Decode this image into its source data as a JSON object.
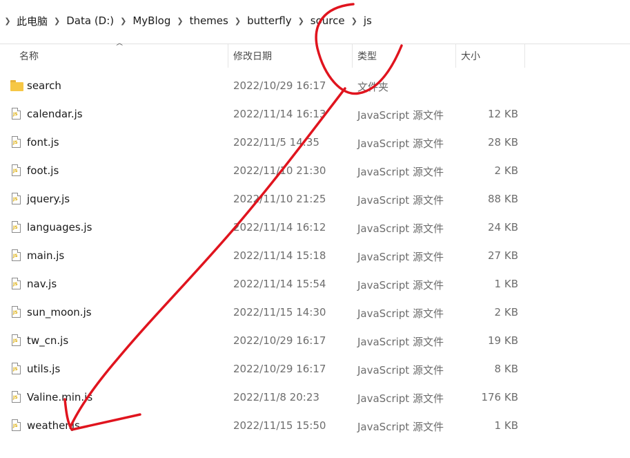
{
  "breadcrumb": [
    "此电脑",
    "Data (D:)",
    "MyBlog",
    "themes",
    "butterfly",
    "source",
    "js"
  ],
  "columns": {
    "name": "名称",
    "date": "修改日期",
    "type": "类型",
    "size": "大小"
  },
  "files": [
    {
      "name": "search",
      "date": "2022/10/29 16:17",
      "type": "文件夹",
      "size": "",
      "icon": "folder-icon"
    },
    {
      "name": "calendar.js",
      "date": "2022/11/14 16:13",
      "type": "JavaScript 源文件",
      "size": "12 KB",
      "icon": "js-file-icon"
    },
    {
      "name": "font.js",
      "date": "2022/11/5 14:35",
      "type": "JavaScript 源文件",
      "size": "28 KB",
      "icon": "js-file-icon"
    },
    {
      "name": "foot.js",
      "date": "2022/11/10 21:30",
      "type": "JavaScript 源文件",
      "size": "2 KB",
      "icon": "js-file-icon"
    },
    {
      "name": "jquery.js",
      "date": "2022/11/10 21:25",
      "type": "JavaScript 源文件",
      "size": "88 KB",
      "icon": "js-file-icon"
    },
    {
      "name": "languages.js",
      "date": "2022/11/14 16:12",
      "type": "JavaScript 源文件",
      "size": "24 KB",
      "icon": "js-file-icon"
    },
    {
      "name": "main.js",
      "date": "2022/11/14 15:18",
      "type": "JavaScript 源文件",
      "size": "27 KB",
      "icon": "js-file-icon"
    },
    {
      "name": "nav.js",
      "date": "2022/11/14 15:54",
      "type": "JavaScript 源文件",
      "size": "1 KB",
      "icon": "js-file-icon"
    },
    {
      "name": "sun_moon.js",
      "date": "2022/11/15 14:30",
      "type": "JavaScript 源文件",
      "size": "2 KB",
      "icon": "js-file-icon"
    },
    {
      "name": "tw_cn.js",
      "date": "2022/10/29 16:17",
      "type": "JavaScript 源文件",
      "size": "19 KB",
      "icon": "js-file-icon"
    },
    {
      "name": "utils.js",
      "date": "2022/10/29 16:17",
      "type": "JavaScript 源文件",
      "size": "8 KB",
      "icon": "js-file-icon"
    },
    {
      "name": "Valine.min.js",
      "date": "2022/11/8 20:23",
      "type": "JavaScript 源文件",
      "size": "176 KB",
      "icon": "js-file-icon"
    },
    {
      "name": "weather.js",
      "date": "2022/11/15 15:50",
      "type": "JavaScript 源文件",
      "size": "1 KB",
      "icon": "js-file-icon"
    }
  ],
  "annotation_color": "#e0141e"
}
